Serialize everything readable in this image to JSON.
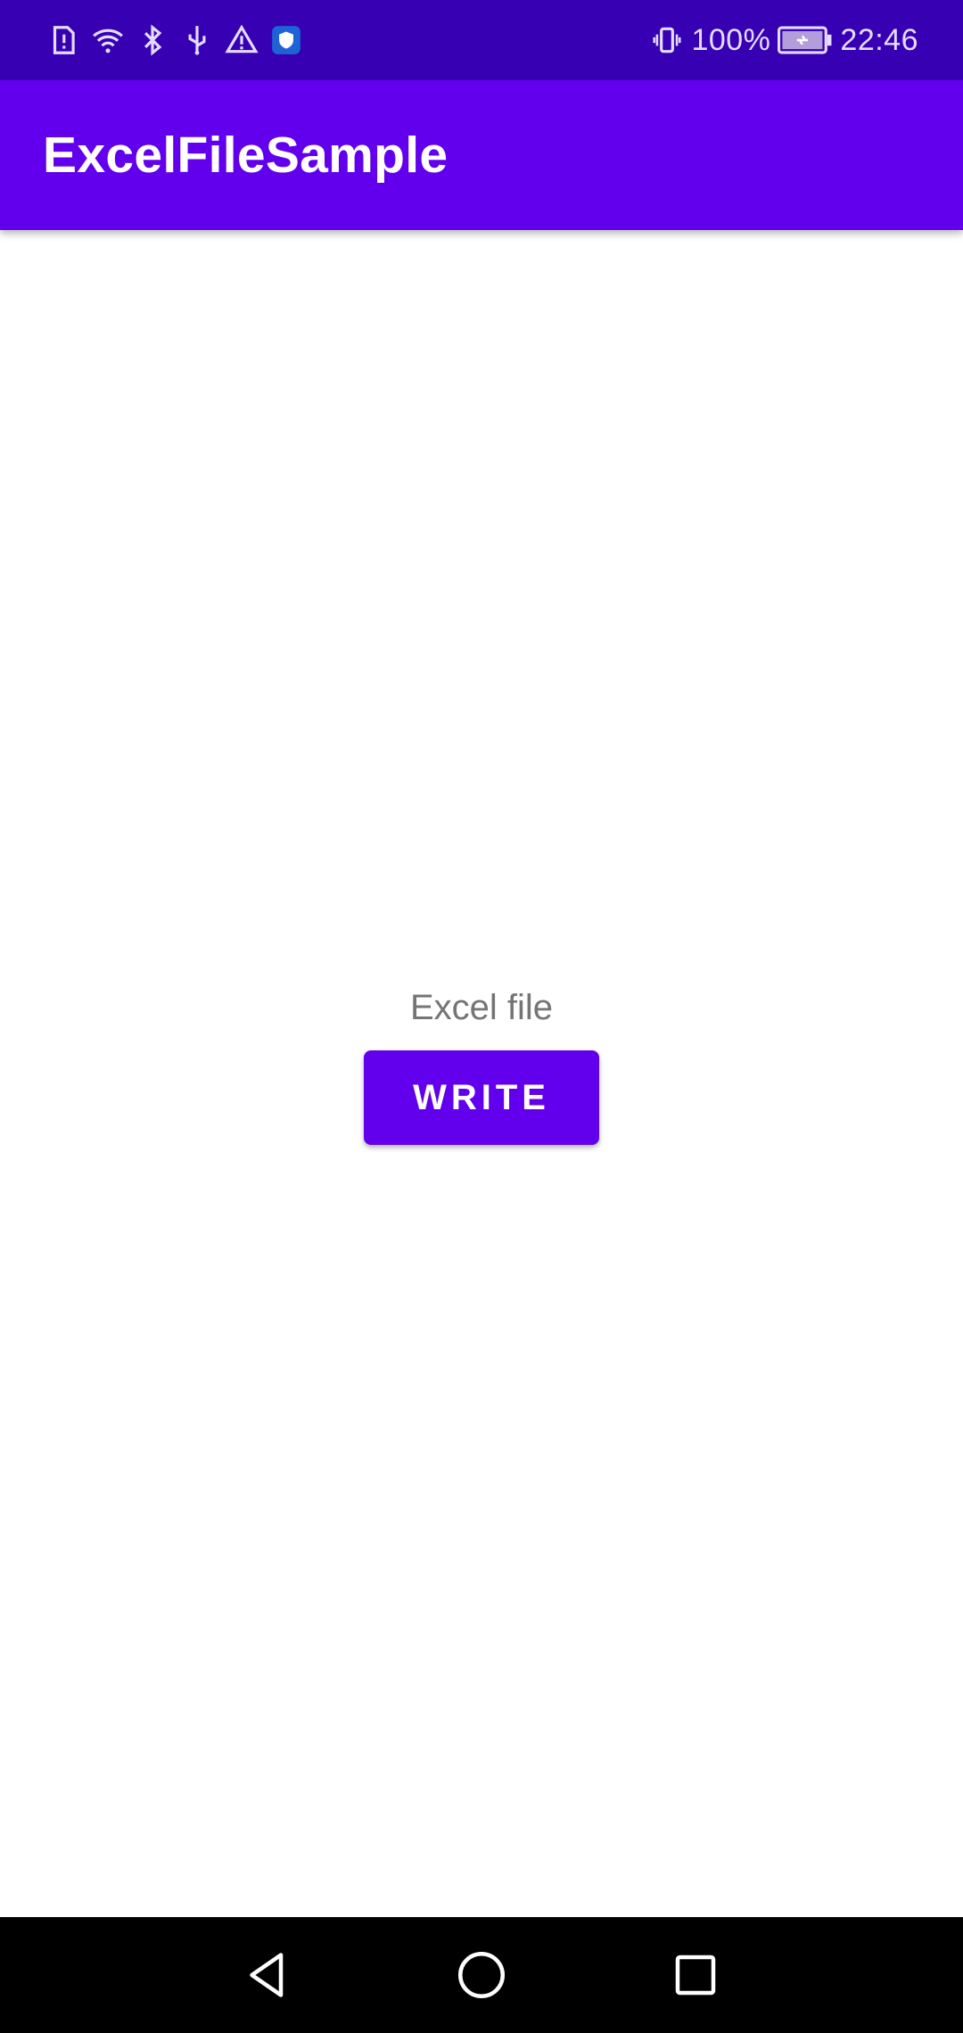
{
  "status_bar": {
    "icons_left": [
      "sim-alert-icon",
      "wifi-icon",
      "bluetooth-icon",
      "usb-icon",
      "warning-icon",
      "shield-icon"
    ],
    "icons_right": [
      "vibrate-icon",
      "battery-charging-icon"
    ],
    "battery_percent": "100%",
    "time": "22:46",
    "background_color": "#3700b3"
  },
  "app_bar": {
    "title": "ExcelFileSample",
    "background_color": "#6200ee"
  },
  "main": {
    "label": "Excel file",
    "write_button_label": "WRITE",
    "button_color": "#6200ee"
  },
  "nav_bar": {
    "icons": [
      "back-icon",
      "home-icon",
      "recents-icon"
    ]
  }
}
